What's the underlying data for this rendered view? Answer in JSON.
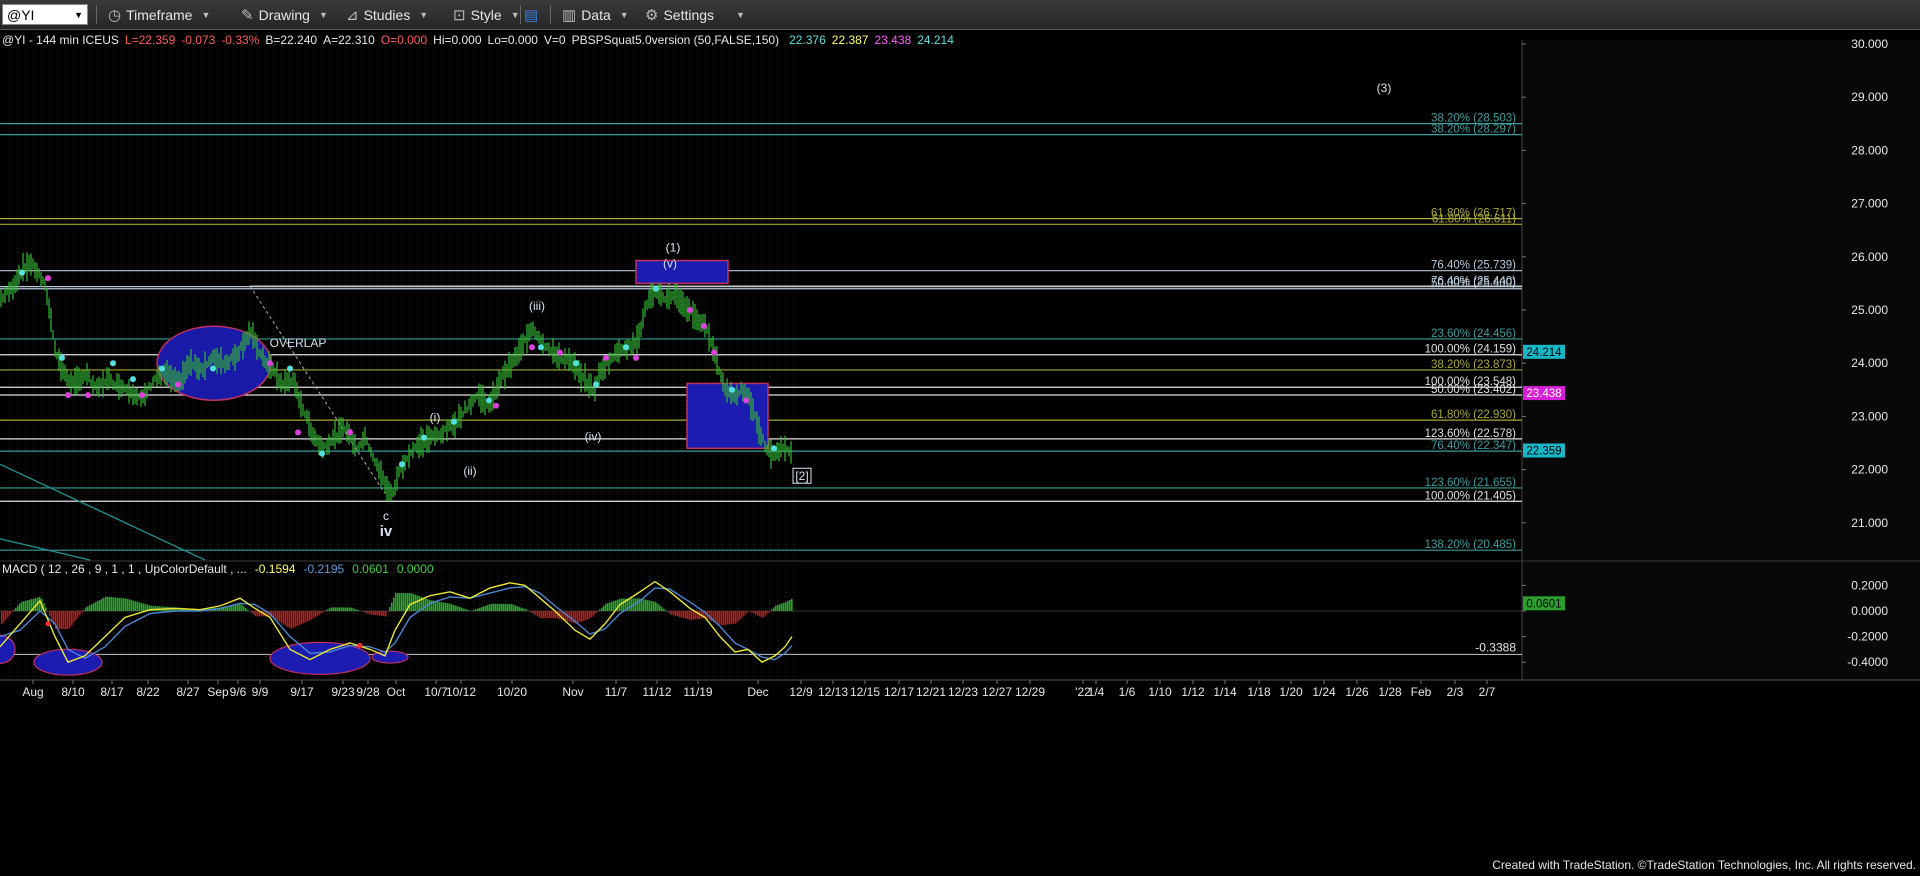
{
  "toolbar": {
    "symbol": "@YI",
    "items": [
      {
        "icon": "clock-icon",
        "label": "Timeframe"
      },
      {
        "icon": "pencil-icon",
        "label": "Drawing"
      },
      {
        "icon": "studies-icon",
        "label": "Studies"
      },
      {
        "icon": "style-icon",
        "label": "Style"
      },
      {
        "icon": "data-icon",
        "label": "Data"
      },
      {
        "icon": "gear-icon",
        "label": "Settings"
      }
    ]
  },
  "header": {
    "symbol_info": "@YI - 144 min  ICEUS",
    "quote": [
      {
        "text": "L=22.359",
        "color": "#ff5a5a"
      },
      {
        "text": "-0.073",
        "color": "#ff5a5a"
      },
      {
        "text": "-0.33%",
        "color": "#ff5a5a"
      },
      {
        "text": "B=22.240",
        "color": "#e8e8e8"
      },
      {
        "text": "A=22.310",
        "color": "#e8e8e8"
      },
      {
        "text": "O=0.000",
        "color": "#ff5a5a"
      },
      {
        "text": "Hi=0.000",
        "color": "#e8e8e8"
      },
      {
        "text": "Lo=0.000",
        "color": "#e8e8e8"
      },
      {
        "text": "V=0",
        "color": "#e8e8e8"
      }
    ],
    "indicator": "PBSPSquat5.0version (50,FALSE,150)",
    "indicator_values": [
      {
        "text": "22.376",
        "color": "#5fe0e0"
      },
      {
        "text": "22.387",
        "color": "#ffff66"
      },
      {
        "text": "23.438",
        "color": "#ff55ff"
      },
      {
        "text": "24.214",
        "color": "#5fe0e0"
      }
    ]
  },
  "macd_header": {
    "label": "MACD ( 12 , 26 , 9 , 1 , 1 , UpColorDefault , ...",
    "values": [
      {
        "text": "-0.1594",
        "color": "#ffff66"
      },
      {
        "text": "-0.2195",
        "color": "#5b9bd5"
      },
      {
        "text": "0.0601",
        "color": "#3fcf3f"
      },
      {
        "text": "0.0000",
        "color": "#3fcf3f"
      }
    ]
  },
  "chart_data": [
    {
      "type": "candlestick",
      "symbol": "@YI",
      "interval": "144 min",
      "ylim": [
        20.3,
        30.3
      ],
      "y_ticks": [
        "30.000",
        "29.000",
        "28.000",
        "27.000",
        "26.000",
        "25.000",
        "24.000",
        "23.000",
        "22.000",
        "21.000"
      ],
      "x_ticks": [
        "Aug",
        "8/10",
        "8/17",
        "8/22",
        "8/27",
        "Sep",
        "9/6",
        "9/9",
        "9/17",
        "9/23",
        "9/28",
        "Oct",
        "10/7",
        "10/12",
        "10/20",
        "Nov",
        "11/7",
        "11/12",
        "11/19",
        "Dec",
        "12/9",
        "12/13",
        "12/15",
        "12/17",
        "12/21",
        "12/23",
        "12/27",
        "12/29",
        "'22",
        "1/4",
        "1/6",
        "1/10",
        "1/12",
        "1/14",
        "1/18",
        "1/20",
        "1/24",
        "1/26",
        "1/28",
        "Feb",
        "2/3",
        "2/7"
      ],
      "price_path": [
        [
          0,
          25.2
        ],
        [
          12,
          25.4
        ],
        [
          20,
          25.7
        ],
        [
          30,
          25.9
        ],
        [
          38,
          25.7
        ],
        [
          46,
          25.4
        ],
        [
          56,
          24.2
        ],
        [
          64,
          23.8
        ],
        [
          74,
          23.6
        ],
        [
          86,
          23.8
        ],
        [
          96,
          23.5
        ],
        [
          106,
          23.7
        ],
        [
          118,
          23.6
        ],
        [
          130,
          23.5
        ],
        [
          142,
          23.3
        ],
        [
          154,
          23.7
        ],
        [
          166,
          23.8
        ],
        [
          178,
          23.6
        ],
        [
          190,
          24.0
        ],
        [
          202,
          23.9
        ],
        [
          214,
          24.1
        ],
        [
          226,
          24.0
        ],
        [
          238,
          24.2
        ],
        [
          250,
          24.6
        ],
        [
          262,
          24.1
        ],
        [
          272,
          23.9
        ],
        [
          282,
          23.6
        ],
        [
          292,
          23.7
        ],
        [
          302,
          23.2
        ],
        [
          312,
          22.7
        ],
        [
          322,
          22.4
        ],
        [
          334,
          22.6
        ],
        [
          346,
          22.8
        ],
        [
          356,
          22.4
        ],
        [
          366,
          22.6
        ],
        [
          376,
          22.1
        ],
        [
          386,
          21.7
        ],
        [
          392,
          21.5
        ],
        [
          400,
          22.0
        ],
        [
          410,
          22.3
        ],
        [
          420,
          22.5
        ],
        [
          432,
          22.6
        ],
        [
          444,
          22.7
        ],
        [
          456,
          22.9
        ],
        [
          468,
          23.2
        ],
        [
          478,
          23.4
        ],
        [
          490,
          23.2
        ],
        [
          500,
          23.7
        ],
        [
          512,
          24.0
        ],
        [
          522,
          24.3
        ],
        [
          532,
          24.7
        ],
        [
          542,
          24.4
        ],
        [
          552,
          24.2
        ],
        [
          562,
          24.1
        ],
        [
          572,
          24.0
        ],
        [
          584,
          23.7
        ],
        [
          594,
          23.5
        ],
        [
          602,
          23.9
        ],
        [
          612,
          24.1
        ],
        [
          622,
          24.3
        ],
        [
          632,
          24.3
        ],
        [
          640,
          24.6
        ],
        [
          648,
          25.2
        ],
        [
          656,
          25.3
        ],
        [
          664,
          25.2
        ],
        [
          674,
          25.3
        ],
        [
          684,
          25.1
        ],
        [
          694,
          24.9
        ],
        [
          704,
          24.7
        ],
        [
          712,
          24.4
        ],
        [
          720,
          23.8
        ],
        [
          726,
          23.5
        ],
        [
          734,
          23.4
        ],
        [
          742,
          23.5
        ],
        [
          750,
          23.3
        ],
        [
          758,
          22.8
        ],
        [
          766,
          22.4
        ],
        [
          774,
          22.3
        ],
        [
          782,
          22.4
        ],
        [
          790,
          22.36
        ]
      ],
      "markers_cyan": [
        [
          22,
          25.7
        ],
        [
          62,
          24.1
        ],
        [
          113,
          24.0
        ],
        [
          133,
          23.7
        ],
        [
          162,
          23.9
        ],
        [
          213,
          23.9
        ],
        [
          290,
          23.9
        ],
        [
          322,
          22.3
        ],
        [
          402,
          22.1
        ],
        [
          424,
          22.6
        ],
        [
          454,
          22.9
        ],
        [
          489,
          23.3
        ],
        [
          541,
          24.3
        ],
        [
          576,
          24.0
        ],
        [
          596,
          23.6
        ],
        [
          626,
          24.3
        ],
        [
          656,
          25.4
        ],
        [
          732,
          23.5
        ],
        [
          774,
          22.4
        ]
      ],
      "markers_magenta": [
        [
          48,
          25.6
        ],
        [
          68,
          23.4
        ],
        [
          88,
          23.4
        ],
        [
          142,
          23.4
        ],
        [
          178,
          23.6
        ],
        [
          270,
          24.0
        ],
        [
          298,
          22.7
        ],
        [
          350,
          22.7
        ],
        [
          496,
          23.2
        ],
        [
          532,
          24.3
        ],
        [
          560,
          24.2
        ],
        [
          606,
          24.1
        ],
        [
          636,
          24.1
        ],
        [
          690,
          25.0
        ],
        [
          704,
          24.7
        ],
        [
          714,
          24.2
        ],
        [
          746,
          23.3
        ]
      ],
      "horizontal_levels": [
        {
          "value": 28.503,
          "label": "38.20% (28.503)",
          "color": "#3a9c9c"
        },
        {
          "value": 28.297,
          "label": "38.20% (28.297)",
          "color": "#3a9c9c"
        },
        {
          "value": 26.717,
          "label": "61.80% (26.717)",
          "color": "#a8a832"
        },
        {
          "value": 26.611,
          "label": "61.80% (26.611)",
          "color": "#a8a832"
        },
        {
          "value": 25.739,
          "label": "76.40% (25.739)",
          "color": "#b8c8d8"
        },
        {
          "value": 25.44,
          "label": "76.40% (25.440)",
          "color": "#b8c8d8"
        },
        {
          "value": 25.4,
          "label": "50.00% (25.400)",
          "color": "#b8c8d8"
        },
        {
          "value": 24.456,
          "label": "23.60% (24.456)",
          "color": "#3a9c9c"
        },
        {
          "value": 24.159,
          "label": "100.00% (24.159)",
          "color": "#e0e0e0"
        },
        {
          "value": 23.873,
          "label": "38.20% (23.873)",
          "color": "#a8a832"
        },
        {
          "value": 23.548,
          "label": "100.00% (23.548)",
          "color": "#e0e0e0"
        },
        {
          "value": 23.402,
          "label": "50.00% (23.402)",
          "color": "#e0e0e0"
        },
        {
          "value": 22.93,
          "label": "61.80% (22.930)",
          "color": "#a8a832"
        },
        {
          "value": 22.578,
          "label": "123.60% (22.578)",
          "color": "#e0e0e0"
        },
        {
          "value": 22.347,
          "label": "76.40% (22.347)",
          "color": "#3a9c9c"
        },
        {
          "value": 21.655,
          "label": "123.60% (21.655)",
          "color": "#3a9c9c"
        },
        {
          "value": 21.405,
          "label": "100.00% (21.405)",
          "color": "#e0e0e0"
        },
        {
          "value": 20.485,
          "label": "138.20% (20.485)",
          "color": "#3a9c9c"
        }
      ],
      "price_badges": [
        {
          "value": 24.214,
          "text": "24.214",
          "bg": "#16b8c8",
          "fg": "#000000"
        },
        {
          "value": 23.438,
          "text": "23.438",
          "bg": "#d81ed8",
          "fg": "#ffffff"
        },
        {
          "value": 22.359,
          "text": "22.359",
          "bg": "#16b8c8",
          "fg": "#000000"
        }
      ],
      "wave_labels": [
        {
          "text": "(3)",
          "x": 1384,
          "y": 29.1
        },
        {
          "text": "(1)",
          "x": 673,
          "y": 26.1
        },
        {
          "text": "(v)",
          "x": 670,
          "y": 25.8
        },
        {
          "text": "(iii)",
          "x": 537,
          "y": 25.0
        },
        {
          "text": "(i)",
          "x": 435,
          "y": 22.9
        },
        {
          "text": "(ii)",
          "x": 470,
          "y": 21.9
        },
        {
          "text": "(iv)",
          "x": 593,
          "y": 22.55
        },
        {
          "text": "c",
          "x": 386,
          "y": 21.05
        },
        {
          "text": "iv",
          "x": 386,
          "y": 20.75
        },
        {
          "text": "[2]",
          "x": 802,
          "y": 21.8
        },
        {
          "text": "OVERLAP",
          "x": 298,
          "y": 24.3
        }
      ]
    },
    {
      "type": "macd",
      "params": "MACD ( 12 , 26 , 9 , 1 , 1 , UpColorDefault , ...",
      "ylim": [
        -0.46,
        0.27
      ],
      "y_ticks": [
        "0.2000",
        "0.0000",
        "-0.2000",
        "-0.4000"
      ],
      "level": -0.3388,
      "macd": [
        [
          0,
          -0.28
        ],
        [
          20,
          -0.1
        ],
        [
          40,
          0.08
        ],
        [
          55,
          -0.2
        ],
        [
          68,
          -0.4
        ],
        [
          85,
          -0.35
        ],
        [
          105,
          -0.2
        ],
        [
          125,
          -0.05
        ],
        [
          150,
          0.01
        ],
        [
          175,
          0.02
        ],
        [
          200,
          0.01
        ],
        [
          220,
          0.04
        ],
        [
          240,
          0.1
        ],
        [
          255,
          0.02
        ],
        [
          270,
          -0.05
        ],
        [
          290,
          -0.3
        ],
        [
          310,
          -0.38
        ],
        [
          330,
          -0.3
        ],
        [
          350,
          -0.25
        ],
        [
          370,
          -0.3
        ],
        [
          385,
          -0.35
        ],
        [
          395,
          -0.15
        ],
        [
          410,
          0.05
        ],
        [
          430,
          0.12
        ],
        [
          450,
          0.15
        ],
        [
          470,
          0.1
        ],
        [
          490,
          0.18
        ],
        [
          510,
          0.22
        ],
        [
          525,
          0.2
        ],
        [
          540,
          0.1
        ],
        [
          555,
          0.0
        ],
        [
          575,
          -0.15
        ],
        [
          590,
          -0.22
        ],
        [
          605,
          -0.1
        ],
        [
          620,
          0.05
        ],
        [
          640,
          0.15
        ],
        [
          655,
          0.23
        ],
        [
          670,
          0.15
        ],
        [
          690,
          0.02
        ],
        [
          705,
          -0.05
        ],
        [
          720,
          -0.2
        ],
        [
          735,
          -0.32
        ],
        [
          748,
          -0.3
        ],
        [
          762,
          -0.4
        ],
        [
          775,
          -0.35
        ],
        [
          785,
          -0.28
        ],
        [
          792,
          -0.2
        ]
      ],
      "signal": [
        [
          0,
          -0.2
        ],
        [
          20,
          -0.15
        ],
        [
          40,
          0.0
        ],
        [
          55,
          -0.1
        ],
        [
          68,
          -0.3
        ],
        [
          85,
          -0.37
        ],
        [
          105,
          -0.28
        ],
        [
          125,
          -0.12
        ],
        [
          150,
          -0.02
        ],
        [
          175,
          0.0
        ],
        [
          200,
          0.0
        ],
        [
          220,
          0.02
        ],
        [
          240,
          0.06
        ],
        [
          255,
          0.05
        ],
        [
          270,
          -0.02
        ],
        [
          290,
          -0.2
        ],
        [
          310,
          -0.33
        ],
        [
          330,
          -0.32
        ],
        [
          350,
          -0.27
        ],
        [
          370,
          -0.28
        ],
        [
          385,
          -0.32
        ],
        [
          395,
          -0.25
        ],
        [
          410,
          -0.05
        ],
        [
          430,
          0.06
        ],
        [
          450,
          0.11
        ],
        [
          470,
          0.1
        ],
        [
          490,
          0.14
        ],
        [
          510,
          0.18
        ],
        [
          525,
          0.19
        ],
        [
          540,
          0.14
        ],
        [
          555,
          0.04
        ],
        [
          575,
          -0.08
        ],
        [
          590,
          -0.18
        ],
        [
          605,
          -0.14
        ],
        [
          620,
          -0.02
        ],
        [
          640,
          0.08
        ],
        [
          655,
          0.18
        ],
        [
          670,
          0.17
        ],
        [
          690,
          0.07
        ],
        [
          705,
          -0.01
        ],
        [
          720,
          -0.12
        ],
        [
          735,
          -0.25
        ],
        [
          748,
          -0.3
        ],
        [
          762,
          -0.36
        ],
        [
          775,
          -0.38
        ],
        [
          785,
          -0.33
        ],
        [
          792,
          -0.27
        ]
      ],
      "markers_red": [
        [
          48,
          -0.1
        ],
        [
          360,
          -0.27
        ]
      ],
      "badges": [
        {
          "value": 0.0601,
          "text": "0.0601",
          "bg": "#2ca02c",
          "fg": "#000000"
        },
        {
          "value": -0.3388,
          "text": "-0.3388",
          "bg": "transparent",
          "fg": "#e6e6e6"
        }
      ]
    }
  ],
  "footer": {
    "text": "Created with TradeStation. ©TradeStation Technologies, Inc. All rights reserved."
  }
}
